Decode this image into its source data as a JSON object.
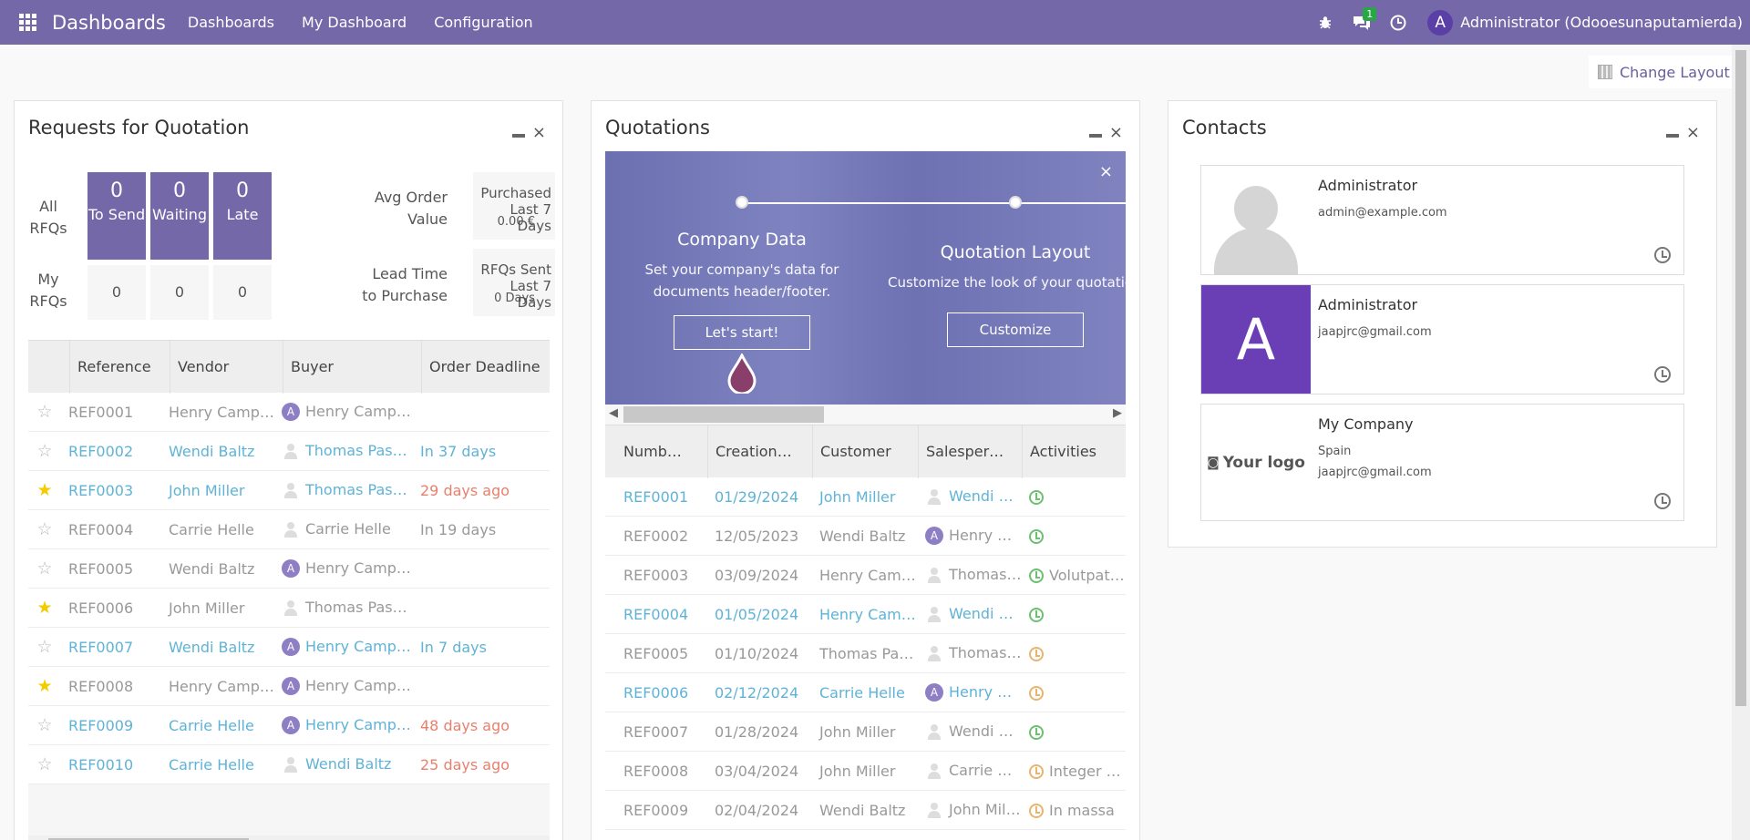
{
  "navbar": {
    "app_title": "Dashboards",
    "menu": [
      "Dashboards",
      "My Dashboard",
      "Configuration"
    ],
    "messages_badge": "1",
    "user_initial": "A",
    "user_name": "Administrator (Odooesunaputamierda)"
  },
  "change_layout": "Change Layout",
  "rfq": {
    "title": "Requests for Quotation",
    "row_all": "All RFQs",
    "row_my": "My RFQs",
    "boxes": [
      {
        "num": "0",
        "label": "To Send"
      },
      {
        "num": "0",
        "label": "Waiting"
      },
      {
        "num": "0",
        "label": "Late"
      }
    ],
    "my_values": [
      "0",
      "0",
      "0"
    ],
    "kpis": [
      {
        "label": "Avg Order Value",
        "value_label": "Purchased Last 7 Days",
        "value": "0.00 €"
      },
      {
        "label": "Lead Time to Purchase",
        "value_label": "RFQs Sent Last 7 Days",
        "value": "0 Days"
      }
    ],
    "columns": [
      "Reference",
      "Vendor",
      "Buyer",
      "Order Deadline"
    ],
    "rows": [
      {
        "ref": "REF0001",
        "vendor": "Henry Campb…",
        "buyer": "Henry Campb…",
        "deadline": "",
        "starred": false,
        "av": "A",
        "color": "grey",
        "dcolor": ""
      },
      {
        "ref": "REF0002",
        "vendor": "Wendi Baltz",
        "buyer": "Thomas Passot",
        "deadline": "In 37 days",
        "starred": false,
        "av": "",
        "color": "blue",
        "dcolor": ""
      },
      {
        "ref": "REF0003",
        "vendor": "John Miller",
        "buyer": "Thomas Passot",
        "deadline": "29 days ago",
        "starred": true,
        "av": "",
        "color": "blue",
        "dcolor": "red"
      },
      {
        "ref": "REF0004",
        "vendor": "Carrie Helle",
        "buyer": "Carrie Helle",
        "deadline": "In 19 days",
        "starred": false,
        "av": "",
        "color": "grey",
        "dcolor": ""
      },
      {
        "ref": "REF0005",
        "vendor": "Wendi Baltz",
        "buyer": "Henry Campb…",
        "deadline": "",
        "starred": false,
        "av": "A",
        "color": "grey",
        "dcolor": ""
      },
      {
        "ref": "REF0006",
        "vendor": "John Miller",
        "buyer": "Thomas Passot",
        "deadline": "",
        "starred": true,
        "av": "",
        "color": "grey",
        "dcolor": ""
      },
      {
        "ref": "REF0007",
        "vendor": "Wendi Baltz",
        "buyer": "Henry Campb…",
        "deadline": "In 7 days",
        "starred": false,
        "av": "A",
        "color": "blue",
        "dcolor": ""
      },
      {
        "ref": "REF0008",
        "vendor": "Henry Campb…",
        "buyer": "Henry Campb…",
        "deadline": "",
        "starred": true,
        "av": "A",
        "color": "grey",
        "dcolor": ""
      },
      {
        "ref": "REF0009",
        "vendor": "Carrie Helle",
        "buyer": "Henry Campb…",
        "deadline": "48 days ago",
        "starred": false,
        "av": "A",
        "color": "blue",
        "dcolor": "red"
      },
      {
        "ref": "REF0010",
        "vendor": "Carrie Helle",
        "buyer": "Wendi Baltz",
        "deadline": "25 days ago",
        "starred": false,
        "av": "",
        "color": "blue",
        "dcolor": "red"
      }
    ]
  },
  "quotations": {
    "title": "Quotations",
    "onboarding": {
      "step1_title": "Company Data",
      "step1_desc": "Set your company's data for documents header/footer.",
      "step1_btn": "Let's start!",
      "step2_title": "Quotation Layout",
      "step2_desc": "Customize the look of your quotatio",
      "step2_btn": "Customize"
    },
    "columns": [
      "Numb…",
      "Creation…",
      "Customer",
      "Salesper…",
      "Activities"
    ],
    "rows": [
      {
        "num": "REF0001",
        "date": "01/29/2024",
        "customer": "John Miller",
        "sales": "Wendi B…",
        "activity": "",
        "act": "green",
        "av": "",
        "color": "blue"
      },
      {
        "num": "REF0002",
        "date": "12/05/2023",
        "customer": "Wendi Baltz",
        "sales": "Henry C…",
        "activity": "",
        "act": "green",
        "av": "A",
        "color": "grey"
      },
      {
        "num": "REF0003",
        "date": "03/09/2024",
        "customer": "Henry Camp…",
        "sales": "Thomas …",
        "activity": "Volutpat …",
        "act": "green",
        "av": "",
        "color": "grey"
      },
      {
        "num": "REF0004",
        "date": "01/05/2024",
        "customer": "Henry Camp…",
        "sales": "Wendi B…",
        "activity": "",
        "act": "green",
        "av": "",
        "color": "blue"
      },
      {
        "num": "REF0005",
        "date": "01/10/2024",
        "customer": "Thomas Pass…",
        "sales": "Thomas …",
        "activity": "",
        "act": "orange",
        "av": "",
        "color": "grey"
      },
      {
        "num": "REF0006",
        "date": "02/12/2024",
        "customer": "Carrie Helle",
        "sales": "Henry C…",
        "activity": "",
        "act": "orange",
        "av": "A",
        "color": "blue"
      },
      {
        "num": "REF0007",
        "date": "01/28/2024",
        "customer": "John Miller",
        "sales": "Wendi B…",
        "activity": "",
        "act": "green",
        "av": "",
        "color": "grey"
      },
      {
        "num": "REF0008",
        "date": "03/04/2024",
        "customer": "John Miller",
        "sales": "Carrie H…",
        "activity": "Integer v…",
        "act": "orange",
        "av": "",
        "color": "grey"
      },
      {
        "num": "REF0009",
        "date": "02/04/2024",
        "customer": "Wendi Baltz",
        "sales": "John Mill…",
        "activity": "In massa",
        "act": "orange",
        "av": "",
        "color": "grey"
      }
    ]
  },
  "contacts": {
    "title": "Contacts",
    "cards": [
      {
        "name": "Administrator",
        "line1": "admin@example.com",
        "line2": "",
        "img": "placeholder"
      },
      {
        "name": "Administrator",
        "line1": "jaapjrc@gmail.com",
        "line2": "",
        "img": "letter",
        "letter": "A"
      },
      {
        "name": "My Company",
        "line1": "Spain",
        "line2": "jaapjrc@gmail.com",
        "img": "logo",
        "logo_text": "Your logo"
      }
    ]
  },
  "colors": {
    "brand": "#7468a8",
    "link": "#5fb3d6",
    "late": "#e8806d",
    "star": "#f3cc00"
  }
}
